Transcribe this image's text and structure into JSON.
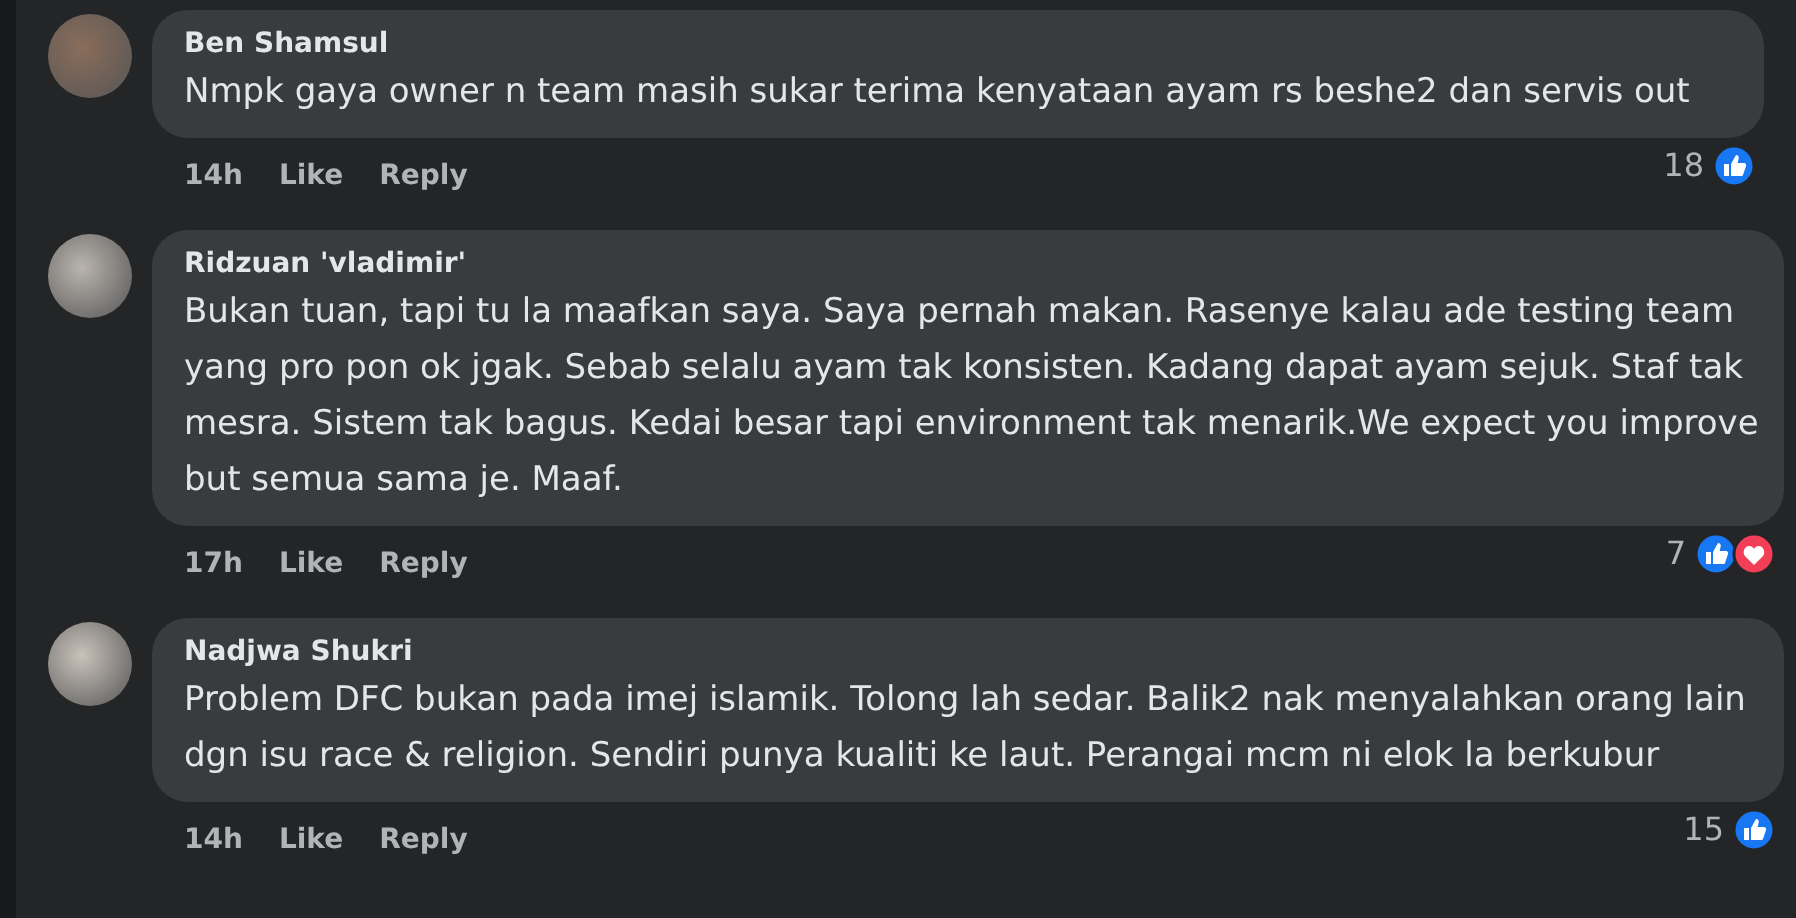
{
  "comments": [
    {
      "author": "Ben Shamsul",
      "text": "Nmpk gaya owner n team masih sukar terima kenyataan ayam rs beshe2 dan servis out",
      "time": "14h",
      "like_label": "Like",
      "reply_label": "Reply",
      "reaction_count": "18",
      "reactions": [
        {
          "kind": "like"
        }
      ]
    },
    {
      "author": "Ridzuan 'vladimir'",
      "text": "Bukan tuan, tapi tu la maafkan saya. Saya pernah makan. Rasenye kalau ade testing team yang pro pon ok jgak. Sebab selalu ayam tak konsisten. Kadang dapat ayam sejuk. Staf tak mesra. Sistem tak bagus. Kedai besar tapi environment tak menarik.We expect you improve but semua sama je. Maaf.",
      "time": "17h",
      "like_label": "Like",
      "reply_label": "Reply",
      "reaction_count": "7",
      "reactions": [
        {
          "kind": "like"
        },
        {
          "kind": "love"
        }
      ]
    },
    {
      "author": "Nadjwa Shukri",
      "text": "Problem DFC bukan pada imej islamik. Tolong lah sedar. Balik2 nak menyalahkan orang lain dgn isu race & religion. Sendiri punya kualiti ke laut. Perangai mcm ni elok la berkubur",
      "time": "14h",
      "like_label": "Like",
      "reply_label": "Reply",
      "reaction_count": "15",
      "reactions": [
        {
          "kind": "like"
        }
      ]
    }
  ]
}
